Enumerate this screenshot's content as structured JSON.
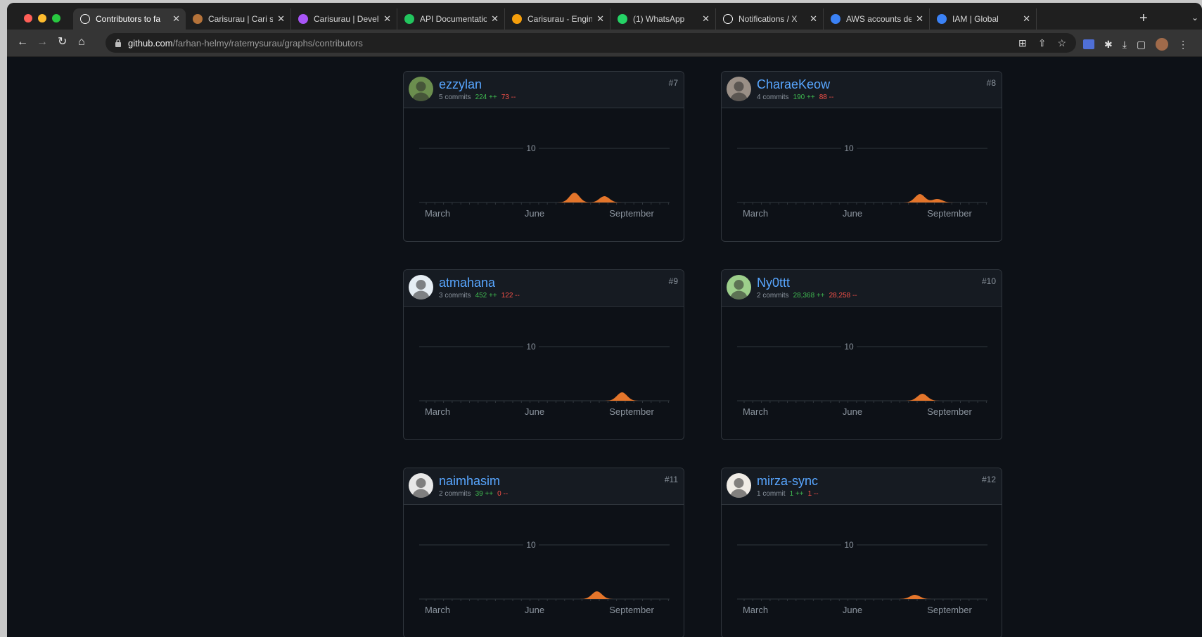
{
  "browser": {
    "tabs": [
      {
        "title": "Contributors to fa",
        "icon": "github-icon",
        "color": "#ffffff",
        "active": true
      },
      {
        "title": "Carisurau | Cari s",
        "icon": "carisurau-icon",
        "color": "#b5733a"
      },
      {
        "title": "Carisurau | Devel",
        "icon": "vite-icon",
        "color": "#a855f7"
      },
      {
        "title": "API Documentatio",
        "icon": "api-docs-icon",
        "color": "#22c55e"
      },
      {
        "title": "Carisurau - Engin",
        "icon": "engine-icon",
        "color": "#f59e0b"
      },
      {
        "title": "(1) WhatsApp",
        "icon": "whatsapp-icon",
        "color": "#25d366"
      },
      {
        "title": "Notifications / X",
        "icon": "x-icon",
        "color": "#ffffff"
      },
      {
        "title": "AWS accounts de",
        "icon": "cloud-icon",
        "color": "#3b82f6"
      },
      {
        "title": "IAM | Global",
        "icon": "cloud-icon",
        "color": "#3b82f6"
      }
    ],
    "url_host": "github.com",
    "url_path": "/farhan-helmy/ratemysurau/graphs/contributors"
  },
  "contributors": [
    {
      "name": "ezzylan",
      "commits": "5 commits",
      "additions": "224 ++",
      "deletions": "73 --",
      "rank": "#7",
      "avatar_color": "#6b8e4e",
      "peaks": [
        [
          0.62,
          14
        ],
        [
          0.74,
          9
        ]
      ]
    },
    {
      "name": "CharaeKeow",
      "commits": "4 commits",
      "additions": "190 ++",
      "deletions": "88 --",
      "rank": "#8",
      "avatar_color": "#9a8f86",
      "peaks": [
        [
          0.73,
          12
        ],
        [
          0.8,
          5
        ]
      ]
    },
    {
      "name": "atmahana",
      "commits": "3 commits",
      "additions": "452 ++",
      "deletions": "122 --",
      "rank": "#9",
      "avatar_color": "#e6eef4",
      "peaks": [
        [
          0.81,
          12
        ]
      ]
    },
    {
      "name": "Ny0ttt",
      "commits": "2 commits",
      "additions": "28,368 ++",
      "deletions": "28,258 --",
      "rank": "#10",
      "avatar_color": "#9dcf8b",
      "peaks": [
        [
          0.74,
          10
        ]
      ]
    },
    {
      "name": "naimhasim",
      "commits": "2 commits",
      "additions": "39 ++",
      "deletions": "0 --",
      "rank": "#11",
      "avatar_color": "#e8e8e8",
      "peaks": [
        [
          0.71,
          11
        ]
      ]
    },
    {
      "name": "mirza-sync",
      "commits": "1 commit",
      "additions": "1 ++",
      "deletions": "1 --",
      "rank": "#12",
      "avatar_color": "#f0ece6",
      "peaks": [
        [
          0.71,
          6
        ]
      ]
    }
  ],
  "chart": {
    "gridline_label": "10",
    "x_labels": [
      "March",
      "June",
      "September"
    ],
    "area_color": "#e3752b"
  }
}
